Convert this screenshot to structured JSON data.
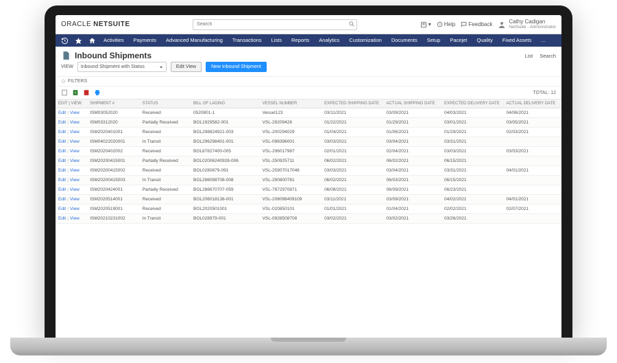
{
  "brand": {
    "part1": "ORACLE",
    "part2": "NETSUITE"
  },
  "search": {
    "placeholder": "Search"
  },
  "header_links": {
    "help": "Help",
    "feedback": "Feedback"
  },
  "user": {
    "name": "Cathy Cadigan",
    "role": "NetSuite - Administrator"
  },
  "menu": [
    "Activities",
    "Payments",
    "Advanced Manufacturing",
    "Transactions",
    "Lists",
    "Reports",
    "Analytics",
    "Customization",
    "Documents",
    "Setup",
    "Pacejet",
    "Quality",
    "Fixed Assets",
    "..."
  ],
  "page": {
    "title": "Inbound Shipments",
    "list_link": "List",
    "search_link": "Search",
    "view_label": "VIEW",
    "view_value": "Inbound Shipment with Status",
    "edit_view": "Edit View",
    "new_btn": "New Inbound Shipment",
    "filters": "FILTERS",
    "total_label": "TOTAL:",
    "total_value": "12"
  },
  "columns": [
    "EDIT | VIEW",
    "SHIPMENT #",
    "STATUS",
    "BILL OF LADING",
    "VESSEL NUMBER",
    "EXPECTED SHIPPING DATE",
    "ACTUAL SHIPPING DATE",
    "EXPECTED DELIVERY DATE",
    "ACTUAL DELIVERY DATE"
  ],
  "action_labels": {
    "edit": "Edit",
    "view": "View"
  },
  "rows": [
    {
      "ship": "ISM03052020",
      "status": "Received",
      "bol": "0520801-1",
      "vessel": "Vessel123",
      "esd": "03/11/2021",
      "asd": "03/09/2021",
      "edd": "04/03/2021",
      "add": "04/06/2021"
    },
    {
      "ship": "ISM03312020",
      "status": "Partially Received",
      "bol": "BOL1929582-001",
      "vessel": "VSL-29209428",
      "esd": "01/22/2021",
      "asd": "01/29/2021",
      "edd": "03/01/2021",
      "add": "03/05/2021"
    },
    {
      "ship": "ISM2020401001",
      "status": "Received",
      "bol": "BOL298824921-003",
      "vessel": "VSL-200294029",
      "esd": "01/04/2021",
      "asd": "01/06/2021",
      "edd": "01/29/2021",
      "add": "02/03/2021"
    },
    {
      "ship": "ISM04022020001",
      "status": "In Transit",
      "bol": "BOL296298401-001",
      "vessel": "VSL-098396001",
      "esd": "03/03/2021",
      "asd": "03/04/2021",
      "edd": "03/31/2021",
      "add": ""
    },
    {
      "ship": "ISM2020402002",
      "status": "Received",
      "bol": "BOL87827400-005",
      "vessel": "VSL-296017987",
      "esd": "02/01/2021",
      "asd": "02/04/2021",
      "edd": "03/03/2021",
      "add": "03/03/2021"
    },
    {
      "ship": "ISM20200415001",
      "status": "Partially Received",
      "bol": "BOL02006240928-006",
      "vessel": "VSL-250925711",
      "esd": "06/02/2021",
      "asd": "06/02/2021",
      "edd": "06/15/2021",
      "add": ""
    },
    {
      "ship": "ISM20200415002",
      "status": "Received",
      "bol": "BOL0280879-091",
      "vessel": "VSL-25907017048",
      "esd": "03/03/2021",
      "asd": "03/04/2021",
      "edd": "03/31/2021",
      "add": "04/01/2021"
    },
    {
      "ship": "ISM20200415003",
      "status": "In Transit",
      "bol": "BOL286098708-008",
      "vessel": "VSL-290800781",
      "esd": "06/02/2021",
      "asd": "06/03/2021",
      "edd": "06/15/2021",
      "add": ""
    },
    {
      "ship": "ISM2020424001",
      "status": "Partially Received",
      "bol": "BOL286670707-059",
      "vessel": "VSL-7872970871",
      "esd": "06/08/2021",
      "asd": "06/09/2021",
      "edd": "06/23/2021",
      "add": ""
    },
    {
      "ship": "ISM2020514001",
      "status": "Received",
      "bol": "BOL206018138-001",
      "vessel": "VSL-208098409109",
      "esd": "03/11/2021",
      "asd": "03/09/2021",
      "edd": "04/02/2021",
      "add": "04/01/2021"
    },
    {
      "ship": "ISM2020519001",
      "status": "Received",
      "bol": "BOL2020501001",
      "vessel": "VSL-020850101",
      "esd": "01/01/2021",
      "asd": "01/04/2021",
      "edd": "02/02/2021",
      "add": "02/07/2021"
    },
    {
      "ship": "ISM20210231002",
      "status": "In Transit",
      "bol": "BOL028979-001",
      "vessel": "VSL-0928508708",
      "esd": "03/02/2021",
      "asd": "03/02/2021",
      "edd": "03/26/2021",
      "add": ""
    }
  ]
}
